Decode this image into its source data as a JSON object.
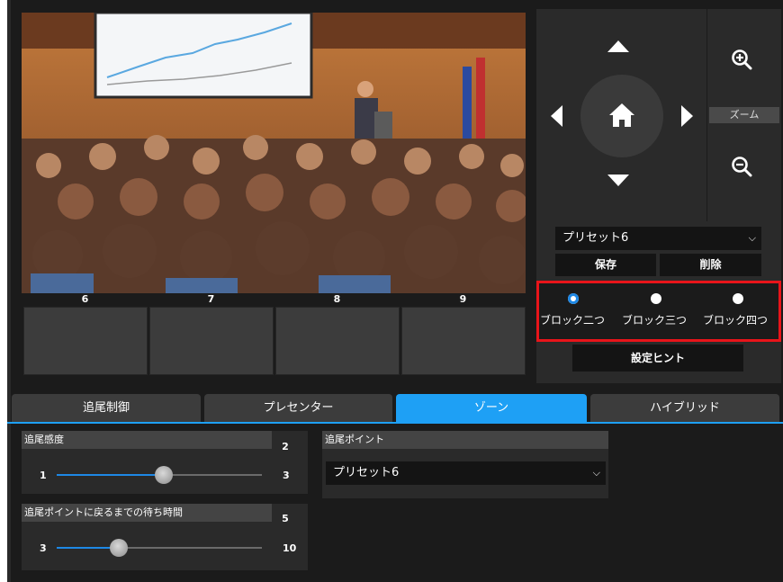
{
  "thumbs": {
    "labels": [
      "6",
      "7",
      "8",
      "9"
    ]
  },
  "ptz": {
    "zoom_label": "ズーム"
  },
  "preset": {
    "selected": "プリセット6",
    "save_label": "保存",
    "delete_label": "削除"
  },
  "zones": {
    "options": [
      "ブロック二つ",
      "ブロック三つ",
      "ブロック四つ"
    ],
    "selected_index": 0
  },
  "hint_button": "設定ヒント",
  "tabs": [
    "追尾制御",
    "プレセンター",
    "ゾーン",
    "ハイブリッド"
  ],
  "active_tab": 2,
  "sensitivity": {
    "label": "追尾感度",
    "value": "2",
    "min": "1",
    "max": "3"
  },
  "wait_time": {
    "label": "追尾ポイントに戻るまでの待ち時間",
    "value": "5",
    "min": "3",
    "max": "10"
  },
  "tracking_point": {
    "label": "追尾ポイント",
    "selected": "プリセット6"
  },
  "colors": {
    "accent": "#1ea0f5",
    "highlight": "#e8141a"
  }
}
